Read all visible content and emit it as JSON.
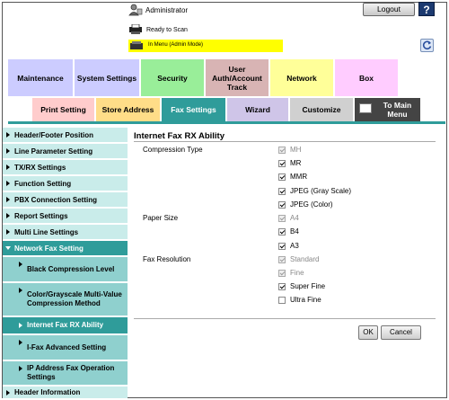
{
  "header": {
    "user": "Administrator",
    "logout": "Logout",
    "help": "?",
    "status": "Ready to Scan",
    "mode": "In Menu (Admin Mode)"
  },
  "tabs_row1": [
    {
      "label": "Maintenance",
      "color": "#ccccff"
    },
    {
      "label": "System Settings",
      "color": "#ccccff"
    },
    {
      "label": "Security",
      "color": "#99ee99"
    },
    {
      "label": "User Auth/Account Track",
      "color": "#d8b4b4"
    },
    {
      "label": "Network",
      "color": "#ffff99"
    },
    {
      "label": "Box",
      "color": "#ffccff"
    }
  ],
  "tabs_row2": [
    {
      "label": "Print Setting",
      "color": "#ffcccc"
    },
    {
      "label": "Store Address",
      "color": "#ffdd88"
    },
    {
      "label": "Fax Settings",
      "color": "#2f9c9a"
    },
    {
      "label": "Wizard",
      "color": "#cfc5e8"
    },
    {
      "label": "Customize",
      "color": "#d0d0d0"
    },
    {
      "label": "To Main Menu",
      "color": "#444444"
    }
  ],
  "sidebar": {
    "items": [
      {
        "label": "Header/Footer Position"
      },
      {
        "label": "Line Parameter Setting"
      },
      {
        "label": "TX/RX Settings"
      },
      {
        "label": "Function Setting"
      },
      {
        "label": "PBX Connection Setting"
      },
      {
        "label": "Report Settings"
      },
      {
        "label": "Multi Line Settings"
      },
      {
        "label": "Network Fax Setting"
      },
      {
        "label": "Black Compression Level"
      },
      {
        "label": "Color/Grayscale Multi-Value Compression Method"
      },
      {
        "label": "Internet Fax RX Ability"
      },
      {
        "label": "I-Fax Advanced Setting"
      },
      {
        "label": "IP Address Fax Operation Settings"
      },
      {
        "label": "Header Information"
      }
    ]
  },
  "content": {
    "title": "Internet Fax RX Ability",
    "compression_label": "Compression Type",
    "paper_label": "Paper Size",
    "resolution_label": "Fax Resolution",
    "options": [
      {
        "label": "MH",
        "checked": true,
        "disabled": true
      },
      {
        "label": "MR",
        "checked": true,
        "disabled": false
      },
      {
        "label": "MMR",
        "checked": true,
        "disabled": false
      },
      {
        "label": "JPEG (Gray Scale)",
        "checked": true,
        "disabled": false
      },
      {
        "label": "JPEG (Color)",
        "checked": true,
        "disabled": false
      },
      {
        "label": "A4",
        "checked": true,
        "disabled": true
      },
      {
        "label": "B4",
        "checked": true,
        "disabled": false
      },
      {
        "label": "A3",
        "checked": true,
        "disabled": false
      },
      {
        "label": "Standard",
        "checked": true,
        "disabled": true
      },
      {
        "label": "Fine",
        "checked": true,
        "disabled": true
      },
      {
        "label": "Super Fine",
        "checked": true,
        "disabled": false
      },
      {
        "label": "Ultra Fine",
        "checked": false,
        "disabled": false
      }
    ],
    "ok": "OK",
    "cancel": "Cancel"
  }
}
